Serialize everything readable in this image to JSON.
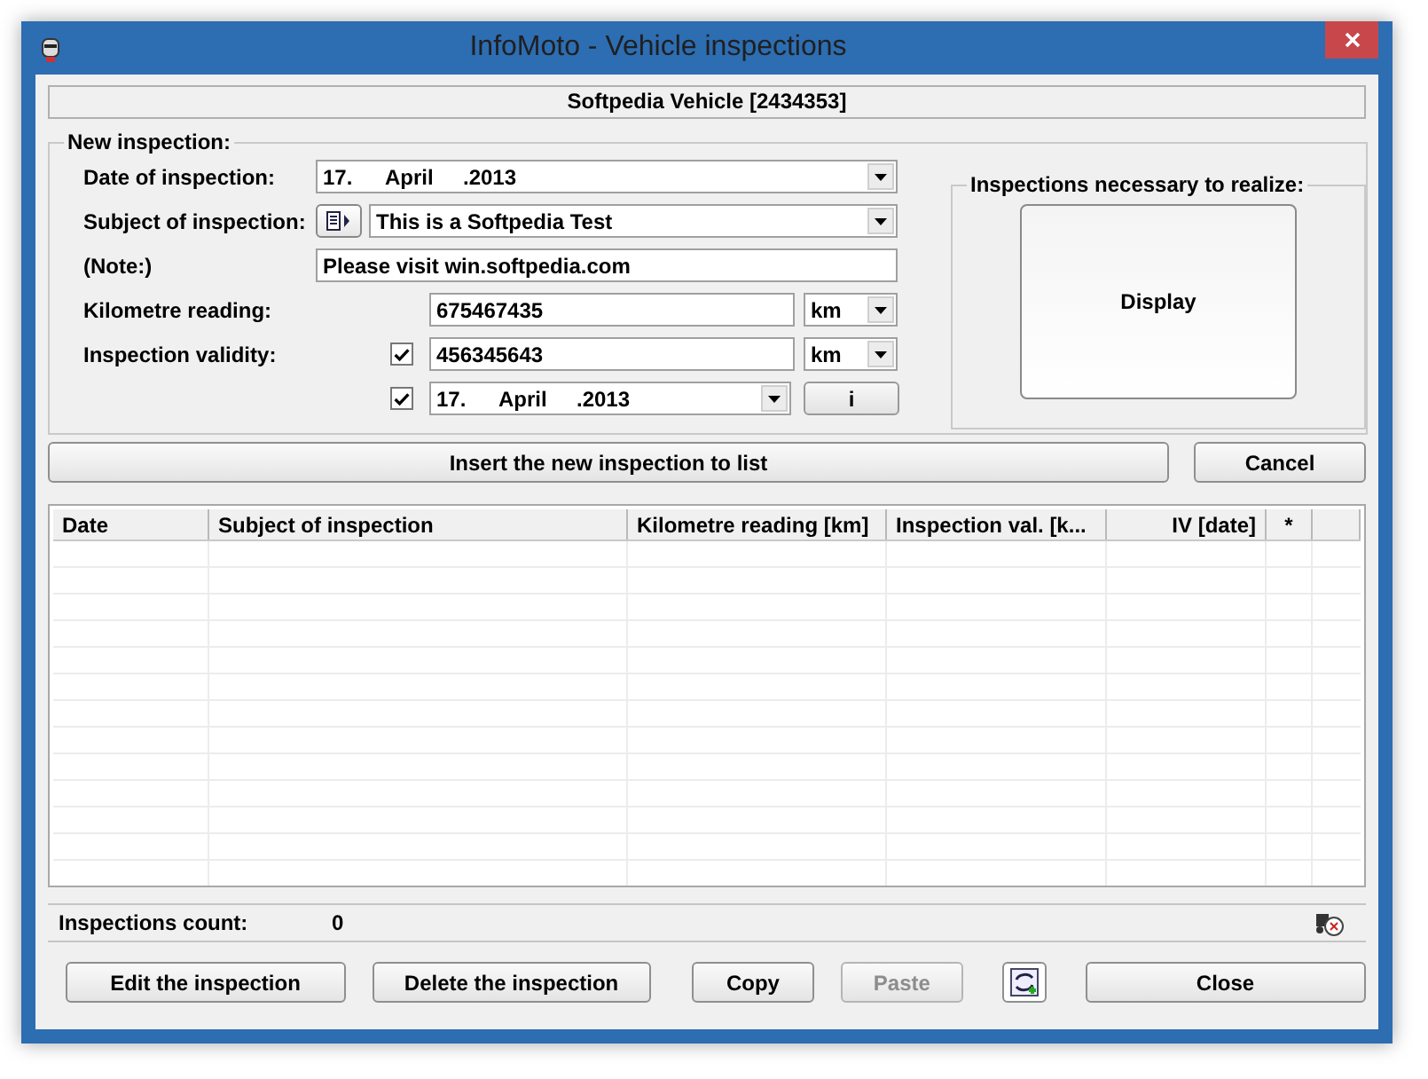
{
  "window": {
    "title": "InfoMoto - Vehicle inspections"
  },
  "vehicle_header": "Softpedia Vehicle [2434353]",
  "new_inspection": {
    "title": "New inspection:",
    "date": {
      "label": "Date of inspection:",
      "value": [
        "17.",
        "April",
        ".2013"
      ]
    },
    "subject": {
      "label": "Subject of inspection:",
      "value": "This is a Softpedia Test"
    },
    "note": {
      "label": "(Note:)",
      "value": "Please visit win.softpedia.com"
    },
    "km": {
      "label": "Kilometre reading:",
      "value": "675467435",
      "unit": "km"
    },
    "validity": {
      "label": "Inspection validity:",
      "km_checked": true,
      "km_value": "456345643",
      "km_unit": "km",
      "date_checked": true,
      "date_value": [
        "17.",
        "April",
        ".2013"
      ],
      "info_button": "i"
    }
  },
  "necessary": {
    "title": "Inspections necessary to realize:",
    "button": "Display"
  },
  "insert_button": "Insert the new inspection to list",
  "cancel_button": "Cancel",
  "table": {
    "columns": [
      {
        "label": "Date"
      },
      {
        "label": "Subject of inspection"
      },
      {
        "label": "Kilometre reading [km]"
      },
      {
        "label": "Inspection val. [k..."
      },
      {
        "label": "IV [date]"
      },
      {
        "label": "*"
      }
    ]
  },
  "status": {
    "label": "Inspections count:",
    "count": "0"
  },
  "footer_buttons": [
    {
      "kind": "text",
      "label": "Edit the inspection",
      "disabled": false
    },
    {
      "kind": "text",
      "label": "Delete the inspection",
      "disabled": false
    },
    {
      "kind": "text",
      "label": "Copy",
      "disabled": false
    },
    {
      "kind": "text",
      "label": "Paste",
      "disabled": true
    },
    {
      "kind": "icon",
      "disabled": false
    },
    {
      "kind": "text",
      "label": "Close",
      "disabled": false
    }
  ]
}
